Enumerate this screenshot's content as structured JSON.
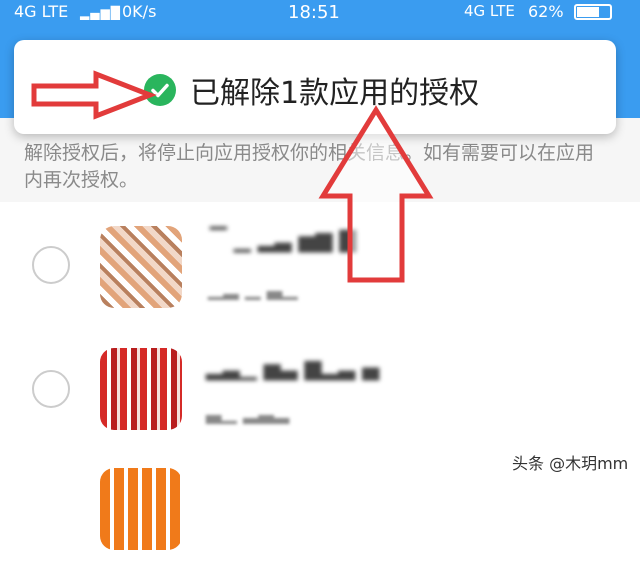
{
  "status_bar": {
    "network": "4G LTE",
    "speed": "0K/s",
    "time": "18:51",
    "network_right": "4G LTE",
    "battery": "62%"
  },
  "toast": {
    "message": "已解除1款应用的授权",
    "icon": "check-circle-icon"
  },
  "info": {
    "text": "解除授权后，将停止向应用授权你的相关信息。如有需要可以在应用内再次授权。"
  },
  "apps": [
    {
      "name": "",
      "subtitle": "",
      "icon": "app-icon-blurred"
    },
    {
      "name": "",
      "subtitle": "",
      "icon": "app-icon-blurred"
    },
    {
      "name": "",
      "subtitle": "",
      "icon": "app-icon-blurred"
    }
  ],
  "watermark": "头条 @木玥mm",
  "colors": {
    "header_blue": "#3a9cf0",
    "check_green": "#2ab55d",
    "annotation_red": "#e23b3b"
  }
}
